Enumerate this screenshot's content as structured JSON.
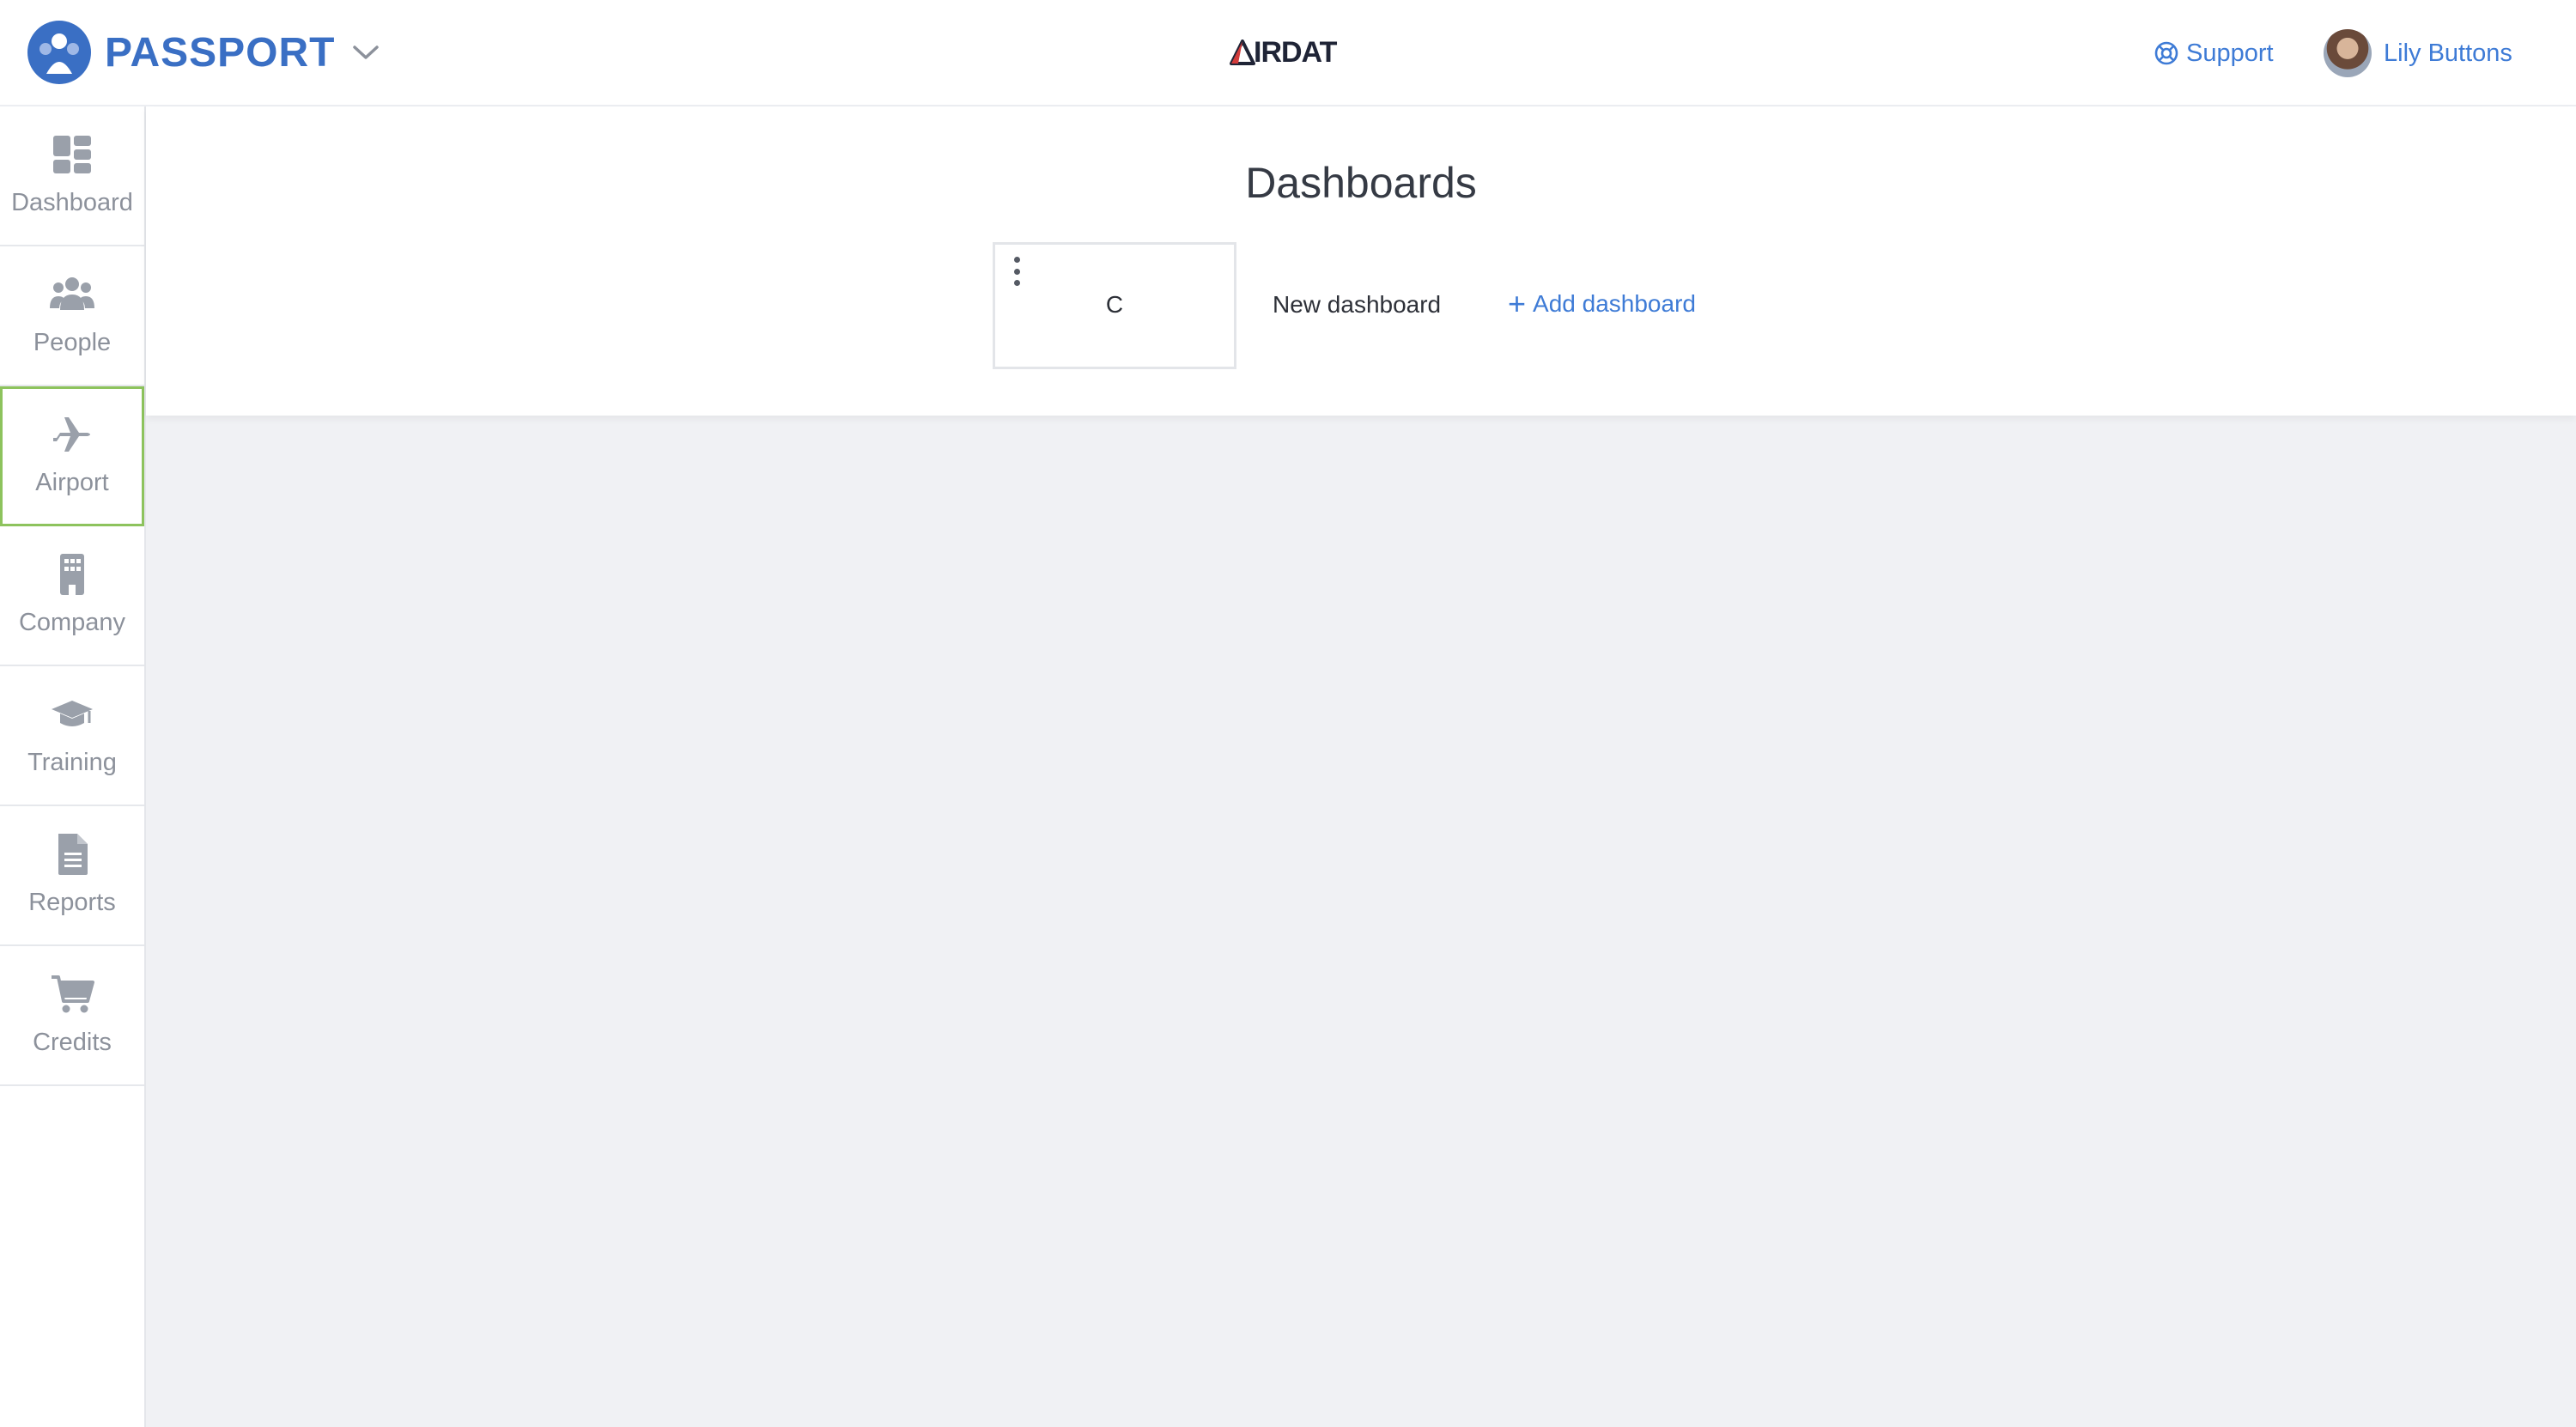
{
  "header": {
    "brand_name": "PASSPORT",
    "center_logo_text": "IRDAT",
    "support_label": "Support",
    "user_name": "Lily Buttons"
  },
  "sidebar": {
    "items": [
      {
        "label": "Dashboard",
        "icon": "dashboard-icon"
      },
      {
        "label": "People",
        "icon": "people-icon"
      },
      {
        "label": "Airport",
        "icon": "airplane-icon",
        "active": true
      },
      {
        "label": "Company",
        "icon": "building-icon"
      },
      {
        "label": "Training",
        "icon": "graduation-cap-icon"
      },
      {
        "label": "Reports",
        "icon": "document-icon"
      },
      {
        "label": "Credits",
        "icon": "cart-icon"
      }
    ]
  },
  "main": {
    "title": "Dashboards",
    "cards": [
      {
        "title": "C"
      }
    ],
    "new_dashboard_label": "New dashboard",
    "add_dashboard_label": "Add dashboard"
  },
  "colors": {
    "brand": "#3a6fc4",
    "link": "#3e7bd6",
    "active_outline": "#8dc35d",
    "fab": "#4e87d8",
    "background": "#f0f1f4"
  }
}
